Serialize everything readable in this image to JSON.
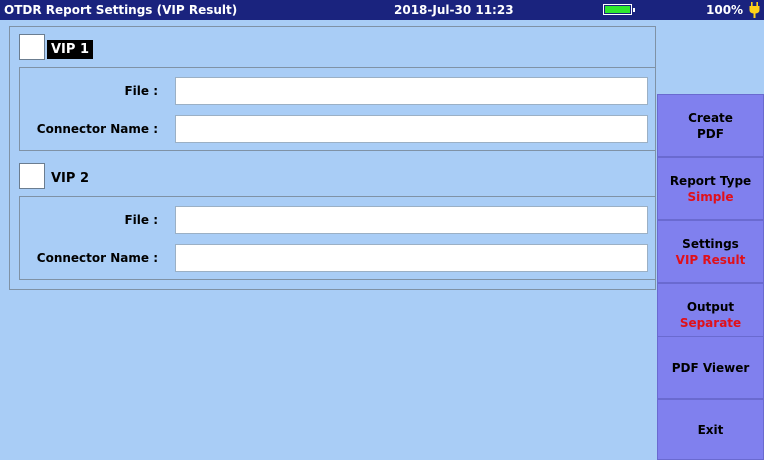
{
  "titlebar": {
    "title": "OTDR Report Settings (VIP Result)",
    "datetime": "2018-Jul-30 11:23",
    "battery_percent": "100%",
    "battery_level": 1.0,
    "battery_color": "#2ee82e"
  },
  "vip1": {
    "label": "VIP 1",
    "checked": false,
    "file_label": "File :",
    "file_value": "",
    "connector_label": "Connector Name :",
    "connector_value": ""
  },
  "vip2": {
    "label": "VIP 2",
    "checked": false,
    "file_label": "File :",
    "file_value": "",
    "connector_label": "Connector Name :",
    "connector_value": ""
  },
  "sidebar": {
    "create_pdf": {
      "line1": "Create",
      "line2": "PDF"
    },
    "report_type": {
      "label": "Report Type",
      "value": "Simple"
    },
    "settings": {
      "label": "Settings",
      "value": "VIP Result"
    },
    "output": {
      "label": "Output",
      "value": "Separate"
    },
    "pdf_viewer": {
      "label": "PDF Viewer"
    },
    "exit": {
      "label": "Exit"
    }
  },
  "colors": {
    "titlebar_bg": "#1a237e",
    "background": "#a9cdf6",
    "button_bg": "#8080ee",
    "value_red": "#e0101a"
  }
}
